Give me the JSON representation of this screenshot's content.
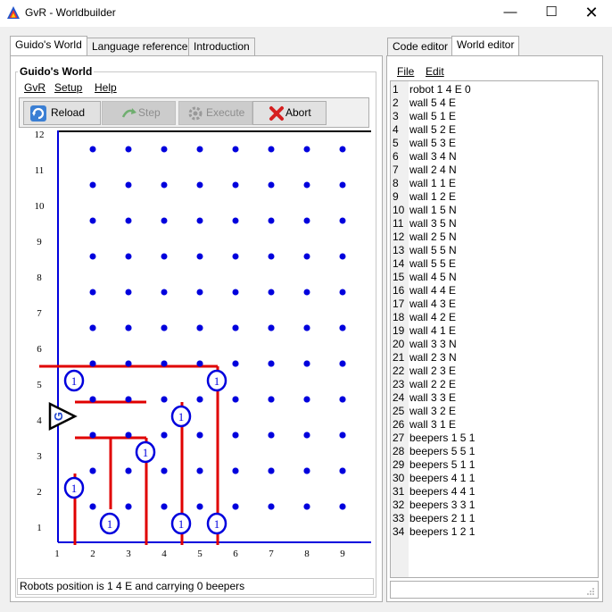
{
  "window": {
    "title": "GvR - Worldbuilder",
    "minimize": "—",
    "maximize": "☐",
    "close": "✕"
  },
  "left_tabs": [
    {
      "label": "Guido's World",
      "active": true
    },
    {
      "label": "Language reference",
      "active": false
    },
    {
      "label": "Introduction",
      "active": false
    }
  ],
  "world_panel": {
    "group_title": "Guido's World",
    "menu": [
      "GvR",
      "Setup",
      "Help"
    ],
    "toolbar": [
      {
        "label": "Reload",
        "icon": "reload-icon",
        "enabled": true
      },
      {
        "label": "Step",
        "icon": "step-icon",
        "enabled": false
      },
      {
        "label": "Execute",
        "icon": "execute-icon",
        "enabled": false
      },
      {
        "label": "Abort",
        "icon": "abort-icon",
        "enabled": true
      }
    ],
    "status": "Robots position is 1 4 E and carrying 0 beepers"
  },
  "world": {
    "x_labels": [
      "1",
      "2",
      "3",
      "4",
      "5",
      "6",
      "7",
      "8",
      "9"
    ],
    "y_labels": [
      "1",
      "2",
      "3",
      "4",
      "5",
      "6",
      "7",
      "8",
      "9",
      "10",
      "11",
      "12"
    ],
    "robot": {
      "x": 1,
      "y": 4,
      "dir": "E",
      "letter": "G"
    },
    "walls": [
      [
        5,
        4,
        "E"
      ],
      [
        5,
        1,
        "E"
      ],
      [
        5,
        2,
        "E"
      ],
      [
        5,
        3,
        "E"
      ],
      [
        3,
        4,
        "N"
      ],
      [
        2,
        4,
        "N"
      ],
      [
        1,
        1,
        "E"
      ],
      [
        1,
        2,
        "E"
      ],
      [
        1,
        5,
        "N"
      ],
      [
        3,
        5,
        "N"
      ],
      [
        2,
        5,
        "N"
      ],
      [
        5,
        5,
        "N"
      ],
      [
        5,
        5,
        "E"
      ],
      [
        4,
        5,
        "N"
      ],
      [
        4,
        4,
        "E"
      ],
      [
        4,
        3,
        "E"
      ],
      [
        4,
        2,
        "E"
      ],
      [
        4,
        1,
        "E"
      ],
      [
        3,
        3,
        "N"
      ],
      [
        2,
        3,
        "N"
      ],
      [
        2,
        3,
        "E"
      ],
      [
        2,
        2,
        "E"
      ],
      [
        3,
        3,
        "E"
      ],
      [
        3,
        2,
        "E"
      ],
      [
        3,
        1,
        "E"
      ]
    ],
    "beepers": [
      {
        "x": 1,
        "y": 5,
        "count": "1"
      },
      {
        "x": 5,
        "y": 5,
        "count": "1"
      },
      {
        "x": 5,
        "y": 1,
        "count": "1"
      },
      {
        "x": 4,
        "y": 1,
        "count": "1"
      },
      {
        "x": 4,
        "y": 4,
        "count": "1"
      },
      {
        "x": 3,
        "y": 3,
        "count": "1"
      },
      {
        "x": 2,
        "y": 1,
        "count": "1"
      },
      {
        "x": 1,
        "y": 2,
        "count": "1"
      }
    ]
  },
  "right_tabs": [
    {
      "label": "Code editor",
      "active": false
    },
    {
      "label": "World editor",
      "active": true
    }
  ],
  "editor_menu": [
    "File",
    "Edit"
  ],
  "editor_lines": [
    "robot 1 4 E 0",
    "wall 5 4 E",
    "wall 5 1 E",
    "wall 5 2 E",
    "wall 5 3 E",
    "wall 3 4 N",
    "wall 2 4 N",
    "wall 1 1 E",
    "wall 1 2 E",
    "wall 1 5 N",
    "wall 3 5 N",
    "wall 2 5 N",
    "wall 5 5 N",
    "wall 5 5 E",
    "wall 4 5 N",
    "wall 4 4 E",
    "wall 4 3 E",
    "wall 4 2 E",
    "wall 4 1 E",
    "wall 3 3 N",
    "wall 2 3 N",
    "wall 2 3 E",
    "wall 2 2 E",
    "wall 3 3 E",
    "wall 3 2 E",
    "wall 3 1 E",
    "beepers 1 5 1",
    "beepers 5 5 1",
    "beepers 5 1 1",
    "beepers 4 1 1",
    "beepers 4 4 1",
    "beepers 3 3 1",
    "beepers 2 1 1",
    "beepers 1 2 1"
  ],
  "colors": {
    "grid": "#0000dd",
    "wall": "#e00000",
    "beeper": "#0000dd",
    "robot": "#000000"
  }
}
